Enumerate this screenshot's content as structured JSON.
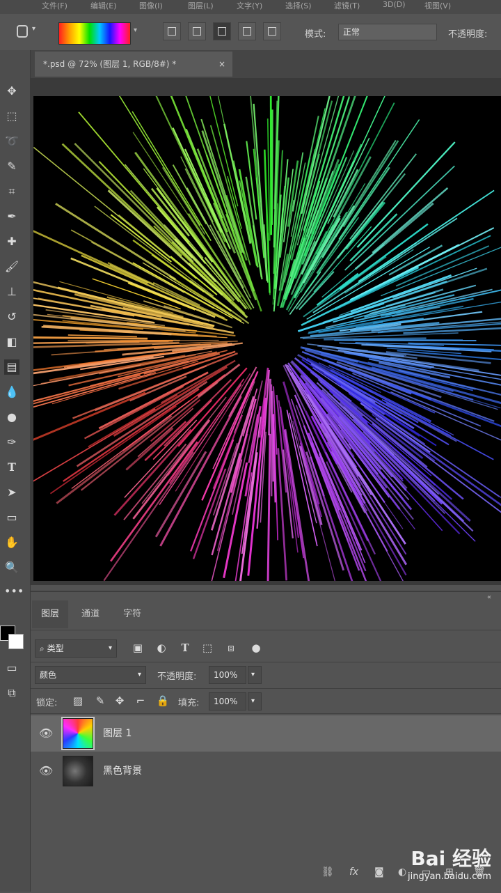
{
  "menubar": {
    "items": [
      "文件(F)",
      "编辑(E)",
      "图像(I)",
      "图层(L)",
      "文字(Y)",
      "选择(S)",
      "滤镜(T)",
      "3D(D)",
      "视图(V)"
    ]
  },
  "options": {
    "mode_label": "模式:",
    "mode_value": "正常",
    "opacity_label": "不透明度:"
  },
  "document_tab": {
    "title": "*.psd @ 72% (图层 1, RGB/8#) *",
    "close": "×"
  },
  "panel": {
    "tabs": [
      "图层",
      "通道",
      "字符"
    ],
    "filter_kind": "类型",
    "blend_mode": "颜色",
    "opacity_label": "不透明度:",
    "opacity_value": "100%",
    "lock_label": "锁定:",
    "fill_label": "填充:",
    "fill_value": "100%",
    "layers": [
      {
        "name": "图层 1",
        "selected": true
      },
      {
        "name": "黑色背景",
        "selected": false
      }
    ]
  },
  "watermark": {
    "brand": "Bai 经验",
    "url": "jingyan.baidu.com"
  },
  "colors": {
    "ui_bg": "#535353",
    "canvas_bg": "#000000",
    "selected_layer": "#686868"
  }
}
